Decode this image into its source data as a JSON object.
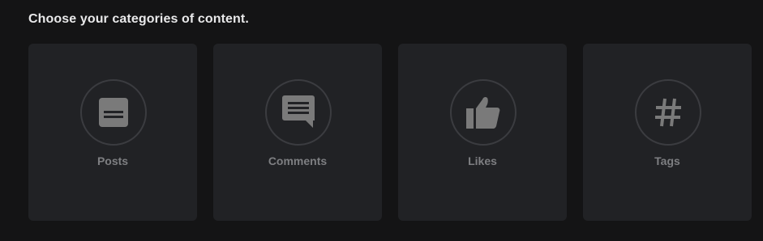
{
  "heading": "Choose your categories of content.",
  "categories": [
    {
      "label": "Posts",
      "icon": "post-icon"
    },
    {
      "label": "Comments",
      "icon": "comment-icon"
    },
    {
      "label": "Likes",
      "icon": "thumbs-up-icon"
    },
    {
      "label": "Tags",
      "icon": "hashtag-icon"
    }
  ],
  "colors": {
    "background": "#141415",
    "card": "#212225",
    "icon": "#7a7a7a",
    "label": "#7e7f82",
    "heading": "#e9e9ea"
  }
}
